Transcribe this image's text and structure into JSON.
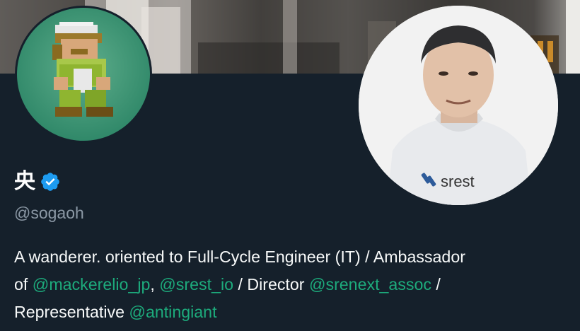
{
  "profile": {
    "display_name": "央",
    "verified_icon": "verified-badge-icon",
    "handle": "@sogaoh",
    "bio": {
      "line1": "A wanderer. oriented to Full-Cycle Engineer (IT) / Ambassador",
      "line2_prefix": "of ",
      "mention_mackerel": "@mackerelio_jp",
      "comma": ", ",
      "mention_srest": "@srest_io",
      "director_text": " / Director ",
      "mention_srenext": "@srenext_assoc",
      "slash_end": " /",
      "representative_text": "Representative ",
      "mention_antingiant": "@antingiant"
    },
    "shirt_logo_text": "srest"
  },
  "colors": {
    "background": "#15202b",
    "text": "#f7f9f9",
    "secondary_text": "#8b98a5",
    "mention": "#1dab7c",
    "verified": "#1d9bf0"
  }
}
